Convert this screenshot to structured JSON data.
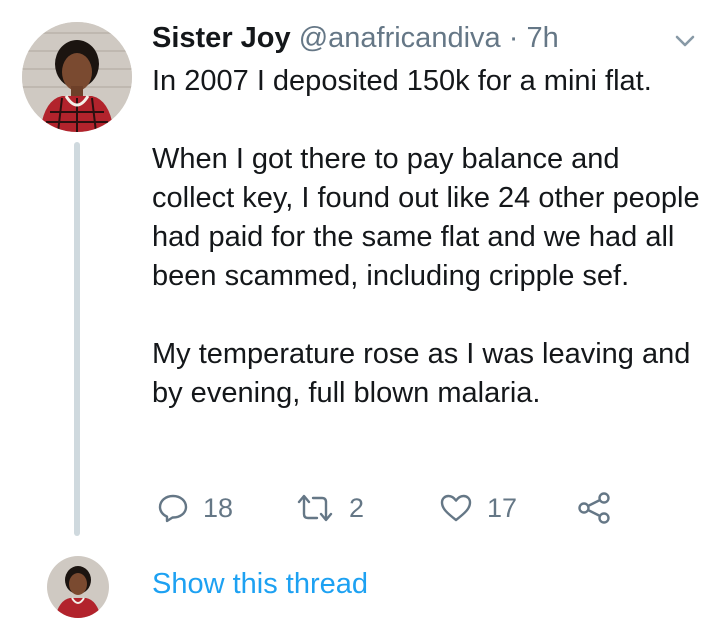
{
  "tweet": {
    "author_name": "Sister Joy",
    "handle": "@anafricandiva",
    "separator": "·",
    "time": "7h",
    "paragraphs": [
      "In 2007 I deposited 150k for a mini flat.",
      "When I got there to pay balance and collect key, I found out like 24 other people had paid for the same flat and we had all been scammed, including cripple sef.",
      "My temperature rose as I was leaving and by evening, full blown malaria."
    ],
    "replies": "18",
    "retweets": "2",
    "likes": "17"
  },
  "thread": {
    "show_label": "Show this thread"
  },
  "icons": {
    "reply": "reply-icon",
    "retweet": "retweet-icon",
    "like": "heart-icon",
    "share": "share-icon",
    "menu": "chevron-down-icon"
  },
  "colors": {
    "link": "#1da1f2",
    "muted": "#657786",
    "thread_line": "#cfd9de",
    "text": "#14171a"
  }
}
